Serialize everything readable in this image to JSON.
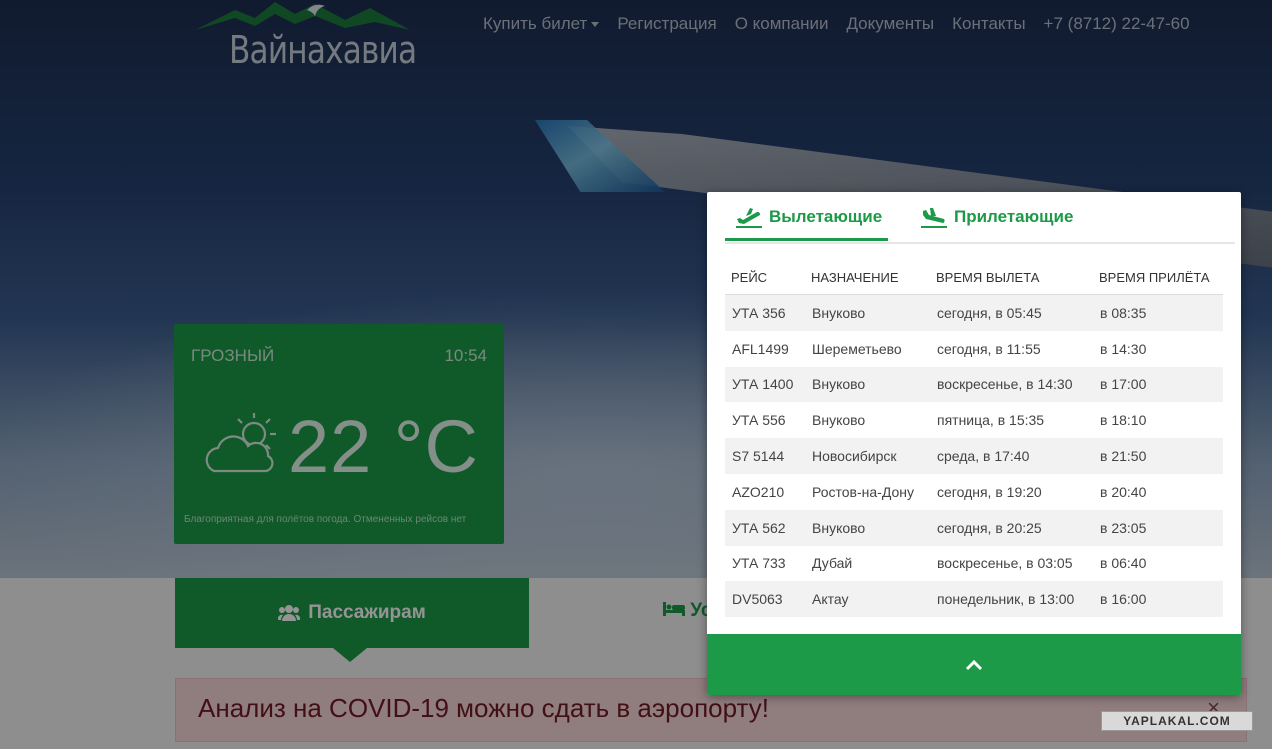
{
  "brand": {
    "name": "Вайнахавиа"
  },
  "nav": {
    "items": [
      "Купить билет",
      "Регистрация",
      "О компании",
      "Документы",
      "Контакты"
    ],
    "phone": "+7 (8712) 22-47-60"
  },
  "weather": {
    "city": "ГРОЗНЫЙ",
    "time": "10:54",
    "temperature": "22 °C",
    "note": "Благоприятная для полётов погода. Отмененных рейсов нет",
    "icon": "partly-cloudy-icon"
  },
  "tabs": {
    "passengers": "Пассажирам",
    "other_partial": "Ус"
  },
  "alert": {
    "text": "Анализ на COVID-19 можно сдать в аэропорту!",
    "close": "×"
  },
  "flights": {
    "tab_departures": "Вылетающие",
    "tab_arrivals": "Прилетающие",
    "headers": [
      "РЕЙС",
      "НАЗНАЧЕНИЕ",
      "ВРЕМЯ ВЫЛЕТА",
      "ВРЕМЯ ПРИЛЁТА"
    ],
    "rows": [
      [
        "УТА 356",
        "Внуково",
        "сегодня, в 05:45",
        "в 08:35"
      ],
      [
        "AFL1499",
        "Шереметьево",
        "сегодня, в 11:55",
        "в 14:30"
      ],
      [
        "УТА 1400",
        "Внуково",
        "воскресенье, в 14:30",
        "в 17:00"
      ],
      [
        "УТА 556",
        "Внуково",
        "пятница, в 15:35",
        "в 18:10"
      ],
      [
        "S7 5144",
        "Новосибирск",
        "среда, в 17:40",
        "в 21:50"
      ],
      [
        "AZO210",
        "Ростов-на-Дону",
        "сегодня, в 19:20",
        "в 20:40"
      ],
      [
        "УТА 562",
        "Внуково",
        "сегодня, в 20:25",
        "в 23:05"
      ],
      [
        "УТА 733",
        "Дубай",
        "воскресенье, в 03:05",
        "в 06:40"
      ],
      [
        "DV5063",
        "Актау",
        "понедельник, в 13:00",
        "в 16:00"
      ]
    ],
    "collapse_icon": "chevron-up-icon"
  },
  "watermark": "YAPLAKAL.COM",
  "colors": {
    "accent": "#1c9a48",
    "alert_bg": "#f8d7da",
    "alert_text": "#721c24"
  }
}
